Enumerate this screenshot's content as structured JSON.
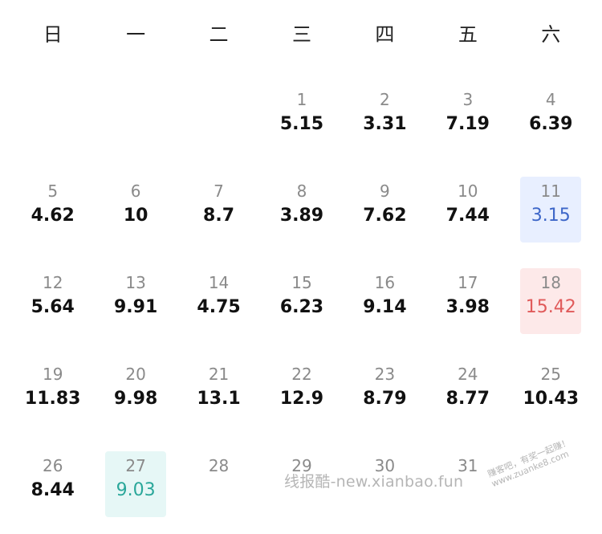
{
  "weekdays": [
    "日",
    "一",
    "二",
    "三",
    "四",
    "五",
    "六"
  ],
  "weeks": [
    [
      null,
      null,
      null,
      {
        "day": "1",
        "value": "5.15"
      },
      {
        "day": "2",
        "value": "3.31"
      },
      {
        "day": "3",
        "value": "7.19"
      },
      {
        "day": "4",
        "value": "6.39"
      }
    ],
    [
      {
        "day": "5",
        "value": "4.62"
      },
      {
        "day": "6",
        "value": "10"
      },
      {
        "day": "7",
        "value": "8.7"
      },
      {
        "day": "8",
        "value": "3.89"
      },
      {
        "day": "9",
        "value": "7.62"
      },
      {
        "day": "10",
        "value": "7.44"
      },
      {
        "day": "11",
        "value": "3.15",
        "highlight": "blue"
      }
    ],
    [
      {
        "day": "12",
        "value": "5.64"
      },
      {
        "day": "13",
        "value": "9.91"
      },
      {
        "day": "14",
        "value": "4.75"
      },
      {
        "day": "15",
        "value": "6.23"
      },
      {
        "day": "16",
        "value": "9.14"
      },
      {
        "day": "17",
        "value": "3.98"
      },
      {
        "day": "18",
        "value": "15.42",
        "highlight": "red"
      }
    ],
    [
      {
        "day": "19",
        "value": "11.83"
      },
      {
        "day": "20",
        "value": "9.98"
      },
      {
        "day": "21",
        "value": "13.1"
      },
      {
        "day": "22",
        "value": "12.9"
      },
      {
        "day": "23",
        "value": "8.79"
      },
      {
        "day": "24",
        "value": "8.77"
      },
      {
        "day": "25",
        "value": "10.43"
      }
    ],
    [
      {
        "day": "26",
        "value": "8.44"
      },
      {
        "day": "27",
        "value": "9.03",
        "highlight": "teal"
      },
      {
        "day": "28",
        "value": ""
      },
      {
        "day": "29",
        "value": ""
      },
      {
        "day": "30",
        "value": ""
      },
      {
        "day": "31",
        "value": ""
      },
      null
    ]
  ],
  "highlight_colors": {
    "blue": "#e8efff",
    "red": "#fde9e9",
    "teal": "#e6f7f6"
  },
  "watermark": "线报酷-new.xianbao.fun",
  "stamp": {
    "line1": "赚客吧，有奖一起赚！",
    "line2": "www.zuanke8.com"
  }
}
